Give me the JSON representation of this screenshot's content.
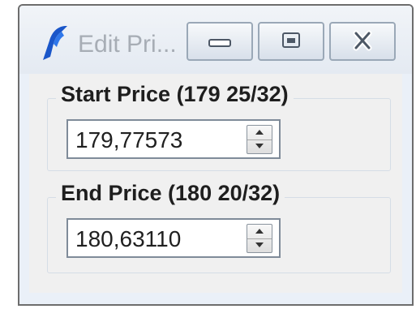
{
  "window": {
    "title": "Edit Pri..."
  },
  "caption_buttons": {
    "minimize_icon": "minimize-icon",
    "maximize_icon": "maximize-icon",
    "close_icon": "close-icon"
  },
  "start_price": {
    "label": "Start Price (179 25/32)",
    "value": "179,77573"
  },
  "end_price": {
    "label": "End Price (180 20/32)",
    "value": "180,63110"
  },
  "colors": {
    "app_icon": "#1a56c9",
    "title_text": "#a7adb5",
    "frame": "#eaf0f8",
    "client": "#f0f0f0"
  }
}
